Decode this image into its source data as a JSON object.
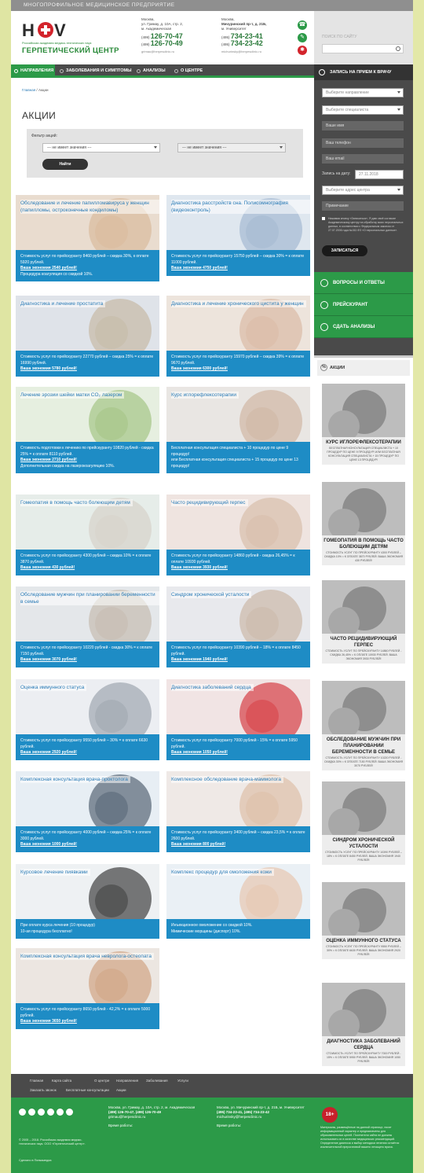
{
  "top_strip": "МНОГОПРОФИЛЬНОЕ МЕДИЦИНСКОЕ ПРЕДПРИЯТИЕ",
  "logo": {
    "mark": "HSV",
    "subtitle": "Российская академия медико-технических наук",
    "title": "ГЕРПЕТИЧЕСКИЙ ЦЕНТР"
  },
  "contacts": [
    {
      "line1": "Москва,",
      "line2": "ул. Гримау, д. 10А, стр. 2,",
      "line3": "м. Академическая",
      "code1": "(499)",
      "phone1": "126-70-47",
      "code2": "(499)",
      "phone2": "126-70-49",
      "email": "grimau@herpesclinic.ru"
    },
    {
      "line1": "Москва,",
      "line2": "Мичуринский пр-т, д. 21Б,",
      "line3": "м. Университет",
      "code1": "(495)",
      "phone1": "734-23-41",
      "code2": "(495)",
      "phone2": "734-23-42",
      "email": "michurinsky@herpesclinic.ru"
    }
  ],
  "search": {
    "label": "ПОИСК ПО САЙТУ"
  },
  "nav": [
    {
      "label": "НАПРАВЛЕНИЯ"
    },
    {
      "label": "ЗАБОЛЕВАНИЯ И СИМПТОМЫ"
    },
    {
      "label": "АНАЛИЗЫ"
    },
    {
      "label": "О ЦЕНТРЕ"
    }
  ],
  "breadcrumb": {
    "home": "Главная",
    "sep": "/",
    "current": "Акции"
  },
  "page_title": "АКЦИИ",
  "filter": {
    "label": "Фильтр акций:",
    "select1": "--- не имеет значения ---",
    "select2": "--- не имеет значения ---",
    "button": "Найти"
  },
  "cards": [
    {
      "title": "Обследование и лечение папилломавируса у женщин (папилломы, остроконечные кондиломы)",
      "text": "Стоимость услуг по прейскуранту 8460 рублей – скидка 30%, к оплате 5920 рублей.",
      "saving": "Ваша экономия 2540 рублей!",
      "extra": "Процедура коагуляция со скидкой 10%."
    },
    {
      "title": "Диагностика расстройств сна. Полисомнография (видеоконтроль)",
      "text": "Стоимость услуг по прейскуранту 15750 рублей – скидка 30% = к оплате 11000 рублей.",
      "saving": "Ваша экономия 4750 рублей!",
      "extra": ""
    },
    {
      "title": "Диагностика и лечение простатита",
      "text": "Стоимость услуг по прейскуранту 22770 рублей – скидка 25% = к оплате 16990 рублей.",
      "saving": "Ваша экономия 5780 рублей!",
      "extra": ""
    },
    {
      "title": "Диагностика и лечение хронического цистита у женщин",
      "text": "Стоимость услуг по прейскуранту 15970 рублей – скидка 39% = к оплате 9670 рублей.",
      "saving": "Ваша экономия 6300 рублей!",
      "extra": ""
    },
    {
      "title": "Лечение эрозии шейки матки CO₂ лазером",
      "text": "Стоимость подготовки к лечению по прейскуранту 10820 рублей - скидка 25% = к оплате 8110 рублей.",
      "saving": "Ваша экономия 2710 рублей!",
      "extra": "Дополнительная скидка на лазерокоагуляцию 10%."
    },
    {
      "title": "Курс иглорефлексотерапии",
      "text": "Бесплатная консультация специалиста + 10 процедур по цене 9 процедур!",
      "saving": "",
      "extra": "или Бесплатная консультация специалиста + 15 процедур по цене 13 процедур!"
    },
    {
      "title": "Гомеопатия в помощь часто болеющим детям",
      "text": "Стоимость услуг по прейскуранту 4300 рублей – скидка 10% = к оплате 3870 рублей.",
      "saving": "Ваша экономия 430 рублей!",
      "extra": ""
    },
    {
      "title": "Часто рецидивирующий герпес",
      "text": "Стоимость услуг по прейскуранту 14860 рублей - скидка 26,45% = к оплате 10930 рублей.",
      "saving": "Ваша экономия 3930 рублей!",
      "extra": ""
    },
    {
      "title": "Обследование мужчин при планировании беременности в семье",
      "text": "Стоимость услуг по прейскуранту 10220 рублей - скидка 30% = к оплате 7150 рублей.",
      "saving": "Ваша экономия 3070 рублей!",
      "extra": ""
    },
    {
      "title": "Синдром хронической усталости",
      "text": "Стоимость услуг по прейскуранту 10390 рублей – 18% = к оплате 8450 рублей.",
      "saving": "Ваша экономия 1940 рублей!",
      "extra": ""
    },
    {
      "title": "Оценка иммунного статуса",
      "text": "Стоимость услуг по прейскуранту 9550 рублей – 30% = к оплате 6630 рублей.",
      "saving": "Ваша экономия 2920 рублей!",
      "extra": ""
    },
    {
      "title": "Диагностика заболеваний сердца",
      "text": "Стоимость услуг по прейскуранту 7000 рублей - 15% = к оплате 5950 рублей.",
      "saving": "Ваша экономия 1050 рублей!",
      "extra": ""
    },
    {
      "title": "Комплексная консультация врача-проктолога",
      "text": "Стоимость услуг по прейскуранту 4000 рублей – скидка 25% = к оплате 3000 рублей.",
      "saving": "Ваша экономия 1000 рублей!",
      "extra": ""
    },
    {
      "title": "Комплексное обследование врача-маммолога",
      "text": "Стоимость услуг по прейскуранту 3400 рублей – скидка 23,5% = к оплате 2600 рублей.",
      "saving": "Ваша экономия 800 рублей!",
      "extra": ""
    },
    {
      "title": "Курсовое лечение пиявками",
      "text": "При оплате курса лечения (10 процедур)",
      "saving": "",
      "extra": "10-ая процедура бесплатно!"
    },
    {
      "title": "Комплекс процедур для омоложения кожи",
      "text": "Инъекционное омоложение со скидкой 10%.",
      "saving": "",
      "extra": "Мимические морщины (диспорт) 10%."
    },
    {
      "title": "Комплексная консультация врача невролога-остеопата",
      "text": "Стоимость услуг по прейскуранту 8650 рублей - 42,2% = к оплате 5000 рублей.",
      "saving": "Ваша экономия 3650 рублей!",
      "extra": ""
    }
  ],
  "sidebar": {
    "form_title": "ЗАПИСЬ НА ПРИЕМ К ВРАЧУ",
    "direction": "Выберите направление",
    "specialist": "Выберите специалиста",
    "name": "Ваше имя",
    "phone": "Ваш телефон",
    "email": "Ваш email",
    "date_label": "Запись на дату:",
    "date_value": "27.11.2018",
    "address": "Выберите адрес центра",
    "note": "Примечание",
    "agree": "Нажимая кнопку «Записаться», Я даю своё согласие Академическому центру на обработку моих персональных данных, в соответствии с Федеральным законом от 27.07.2006 года №152-ФЗ «О персональных данных».",
    "submit": "ЗАПИСАТЬСЯ",
    "links": [
      "ВОПРОСЫ И ОТВЕТЫ",
      "ПРЕЙСКУРАНТ",
      "СДАТЬ АНАЛИЗЫ"
    ],
    "promos_title": "АКЦИИ",
    "promos": [
      {
        "title": "КУРС ИГЛОРЕФЛЕКСОТЕРАПИИ",
        "text": "БЕСПЛАТНАЯ КОНСУЛЬТАЦИЯ СПЕЦИАЛИСТА + 10 ПРОЦЕДУР ПО ЦЕНЕ 9 ПРОЦЕДУР! ИЛИ БЕСПЛАТНАЯ КОНСУЛЬТАЦИЯ СПЕЦИАЛИСТА + 15 ПРОЦЕДУР ПО ЦЕНЕ 13 ПРОЦЕДУР!"
      },
      {
        "title": "ГОМЕОПАТИЯ В ПОМОЩЬ ЧАСТО БОЛЕЮЩИМ ДЕТЯМ",
        "text": "СТОИМОСТЬ УСЛУГ ПО ПРЕЙСКУРАНТУ 4300 РУБЛЕЙ – СКИДКА 10% = К ОПЛАТЕ 3870 РУБЛЕЙ. ВАША ЭКОНОМИЯ 430 РУБЛЕЙ!"
      },
      {
        "title": "ЧАСТО РЕЦИДИВИРУЮЩИЙ ГЕРПЕС",
        "text": "СТОИМОСТЬ УСЛУГ ПО ПРЕЙСКУРАНТУ 14860 РУБЛЕЙ - СКИДКА 26,45% = К ОПЛАТЕ 10930 РУБЛЕЙ. ВАША ЭКОНОМИЯ 3930 РУБЛЕЙ!"
      },
      {
        "title": "ОБСЛЕДОВАНИЕ МУЖЧИН ПРИ ПЛАНИРОВАНИИ БЕРЕМЕННОСТИ В СЕМЬЕ",
        "text": "СТОИМОСТЬ УСЛУГ ПО ПРЕЙСКУРАНТУ 10220 РУБЛЕЙ - СКИДКА 30% = К ОПЛАТЕ 7150 РУБЛЕЙ. ВАША ЭКОНОМИЯ 3070 РУБЛЕЙ!"
      },
      {
        "title": "СИНДРОМ ХРОНИЧЕСКОЙ УСТАЛОСТИ",
        "text": "СТОИМОСТЬ УСЛУГ ПО ПРЕЙСКУРАНТУ 10390 РУБЛЕЙ – 18% = К ОПЛАТЕ 8450 РУБЛЕЙ. ВАША ЭКОНОМИЯ 1940 РУБЛЕЙ!"
      },
      {
        "title": "ОЦЕНКА ИММУННОГО СТАТУСА",
        "text": "СТОИМОСТЬ УСЛУГ ПО ПРЕЙСКУРАНТУ 9550 РУБЛЕЙ – 30% = К ОПЛАТЕ 6630 РУБЛЕЙ. ВАША ЭКОНОМИЯ 2920 РУБЛЕЙ!"
      },
      {
        "title": "ДИАГНОСТИКА ЗАБОЛЕВАНИЙ СЕРДЦА",
        "text": "СТОИМОСТЬ УСЛУГ ПО ПРЕЙСКУРАНТУ 7000 РУБЛЕЙ - 15% = К ОПЛАТЕ 5950 РУБЛЕЙ. ВАША ЭКОНОМИЯ 1050 РУБЛЕЙ!"
      }
    ]
  },
  "footer_links": [
    "Главная",
    "Карта сайта",
    "О центре",
    "Направления",
    "Заболевания",
    "Услуги",
    "Заказать звонок",
    "Бесплатные консультации",
    "Акции"
  ],
  "footer": {
    "copyright": "© 2005 – 2018. Российская академия медико-технических наук. ООО «Герпетический центр».",
    "dev": "Сделано в Пинкамедиа",
    "addr1": "Москва, ул. Гримау, д. 10А, стр. 2, м. Академическая",
    "phones1": "(499) 126-70-47, (499) 126-70-49",
    "mail1": "grimau@herpesclinic.ru",
    "addr2": "Москва, ул. Мичуринский пр-т, д. 21Б, м. Университет",
    "phones2": "(495) 734-23-41, (495) 734-23-42",
    "mail2": "michurinsky@herpesclinic.ru",
    "hours_label": "Время работы:",
    "age": "18+",
    "disclaimer": "Материалы, размещённые на данной странице, носят информационный характер и предназначены для образовательных целей. Посетители сайта не должны использовать их в качестве медицинских рекомендаций. Определение диагноза и выбор методики лечения остаётся исключительной прерогативой вашего лечащего врача."
  },
  "colors": {
    "green": "#2c9a48",
    "blue": "#1e8cc5",
    "dark": "#4a4a4a"
  }
}
